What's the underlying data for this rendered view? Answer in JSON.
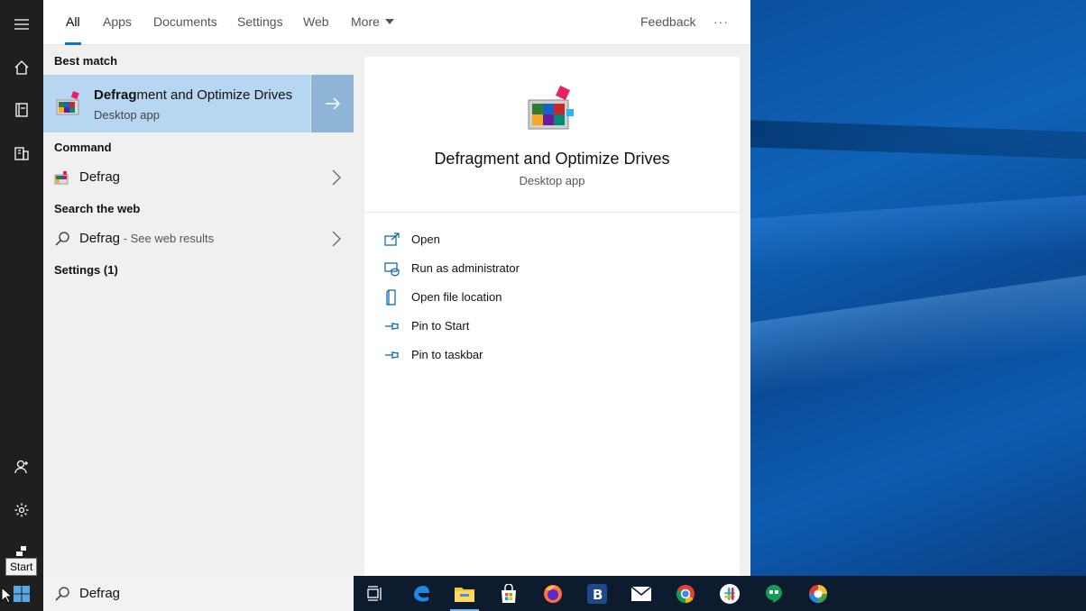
{
  "search": {
    "query": "Defrag"
  },
  "tooltip": "Start",
  "tabs": [
    {
      "label": "All",
      "active": true
    },
    {
      "label": "Apps"
    },
    {
      "label": "Documents"
    },
    {
      "label": "Settings"
    },
    {
      "label": "Web"
    },
    {
      "label": "More"
    }
  ],
  "header": {
    "feedback_label": "Feedback",
    "overflow_label": "···"
  },
  "results": {
    "best_match_title": "Best match",
    "best_match": {
      "title_bold": "Defrag",
      "title_rest": "ment and Optimize Drives",
      "subtitle": "Desktop app"
    },
    "command_title": "Command",
    "command_item": {
      "label": "Defrag"
    },
    "web_title": "Search the web",
    "web_item": {
      "label": "Defrag",
      "suffix": " - See web results"
    },
    "settings_title": "Settings (1)"
  },
  "preview": {
    "title": "Defragment and Optimize Drives",
    "subtitle": "Desktop app",
    "actions": [
      {
        "label": "Open",
        "icon": "open-icon"
      },
      {
        "label": "Run as administrator",
        "icon": "shield-icon"
      },
      {
        "label": "Open file location",
        "icon": "file-location-icon"
      },
      {
        "label": "Pin to Start",
        "icon": "pin-icon"
      },
      {
        "label": "Pin to taskbar",
        "icon": "pin-icon"
      }
    ]
  },
  "taskbar": {
    "apps": [
      "task-view",
      "edge",
      "file-explorer",
      "store",
      "firefox",
      "b-app",
      "mail",
      "chrome",
      "slack",
      "hangouts",
      "photos"
    ]
  },
  "colors": {
    "accent": "#0078d7",
    "selection": "#b6d6f1",
    "rail": "#1f1f1f"
  }
}
